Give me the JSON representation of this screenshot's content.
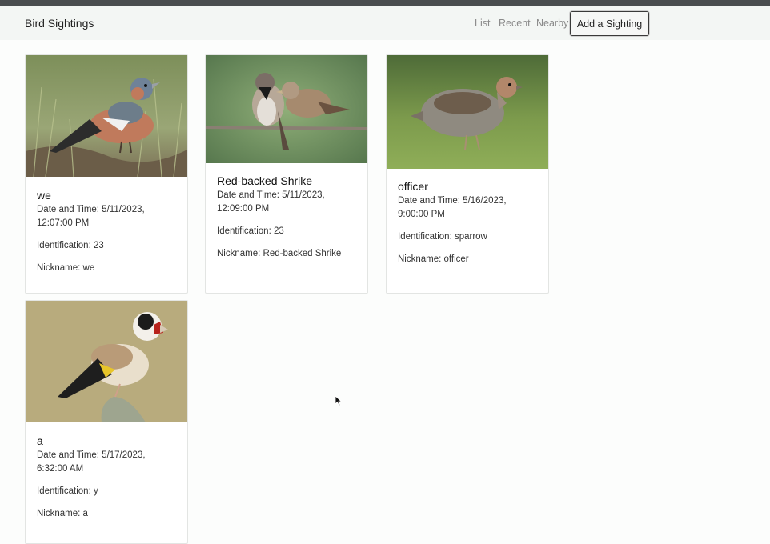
{
  "nav": {
    "brand": "Bird Sightings",
    "links": [
      "List",
      "Recent",
      "Nearby"
    ],
    "add_button": "Add a Sighting"
  },
  "sightings": [
    {
      "photo": "chaffinch-photo",
      "nickname_title": "we",
      "datetime_line1": "Date and Time: 5/11/2023,",
      "datetime_line2": "12:07:00 PM",
      "identification": "Identification: 23",
      "nickname": "Nickname: we"
    },
    {
      "photo": "sparrows-photo",
      "nickname_title": "Red-backed Shrike",
      "datetime_line1": "Date and Time: 5/11/2023,",
      "datetime_line2": "12:09:00 PM",
      "identification": "Identification: 23",
      "nickname": "Nickname: Red-backed Shrike"
    },
    {
      "photo": "partridge-photo",
      "nickname_title": "officer",
      "datetime_line1": "Date and Time: 5/16/2023,",
      "datetime_line2": "9:00:00 PM",
      "identification": "Identification: sparrow",
      "nickname": "Nickname: officer"
    },
    {
      "photo": "goldfinch-photo",
      "nickname_title": "a",
      "datetime_line1": "Date and Time: 5/17/2023,",
      "datetime_line2": "6:32:00 AM",
      "identification": "Identification: y",
      "nickname": "Nickname: a"
    }
  ]
}
